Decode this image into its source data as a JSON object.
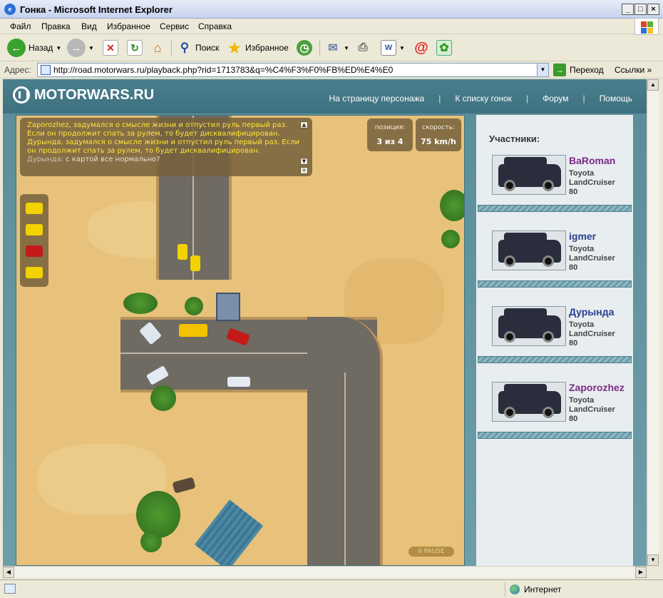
{
  "window": {
    "title": "Гонка - Microsoft Internet Explorer"
  },
  "menu": [
    "Файл",
    "Правка",
    "Вид",
    "Избранное",
    "Сервис",
    "Справка"
  ],
  "toolbar": {
    "back": "Назад",
    "search": "Поиск",
    "favorites": "Избранное"
  },
  "address": {
    "label": "Адрес:",
    "url": "http://road.motorwars.ru/playback.php?rid=1713783&q=%C4%F3%F0%FB%ED%E4%E0",
    "go": "Переход",
    "links": "Ссылки"
  },
  "site": {
    "logo": "MOTORWARS.RU",
    "nav": [
      "На страницу персонажа",
      "К списку гонок",
      "Форум",
      "Помощь"
    ]
  },
  "game": {
    "chat": [
      {
        "text": "Zaporozhez, задумался о смысле жизни и отпустил руль первый раз. Если он продолжит спать за рулем, то будет дисквалифицирован.",
        "style": "yellow"
      },
      {
        "text": "Дурында, задумался о смысле жизни и отпустил руль первый раз. Если он продолжит спать за рулем, то будет дисквалифицирован.",
        "style": "yellow"
      },
      {
        "speaker": "Дурында:",
        "text": "с картой все нормально?",
        "style": "gray"
      }
    ],
    "position_label": "позиция:",
    "position_value": "3 из 4",
    "speed_label": "скорость:",
    "speed_value": "75 km/h",
    "pause": "II PAUSE"
  },
  "participants": {
    "title": "Участники:",
    "list": [
      {
        "name": "BaRoman",
        "car1": "Toyota",
        "car2": "LandCruiser",
        "car3": "80",
        "color": "#7b2a86"
      },
      {
        "name": "igmer",
        "car1": "Toyota",
        "car2": "LandCruiser",
        "car3": "80",
        "color": "#2a3f8f"
      },
      {
        "name": "Дурында",
        "car1": "Toyota",
        "car2": "LandCruiser",
        "car3": "80",
        "color": "#2a3f8f"
      },
      {
        "name": "Zaporozhez",
        "car1": "Toyota",
        "car2": "LandCruiser",
        "car3": "80",
        "color": "#7b2a86"
      }
    ]
  },
  "status": {
    "zone": "Интернет"
  }
}
